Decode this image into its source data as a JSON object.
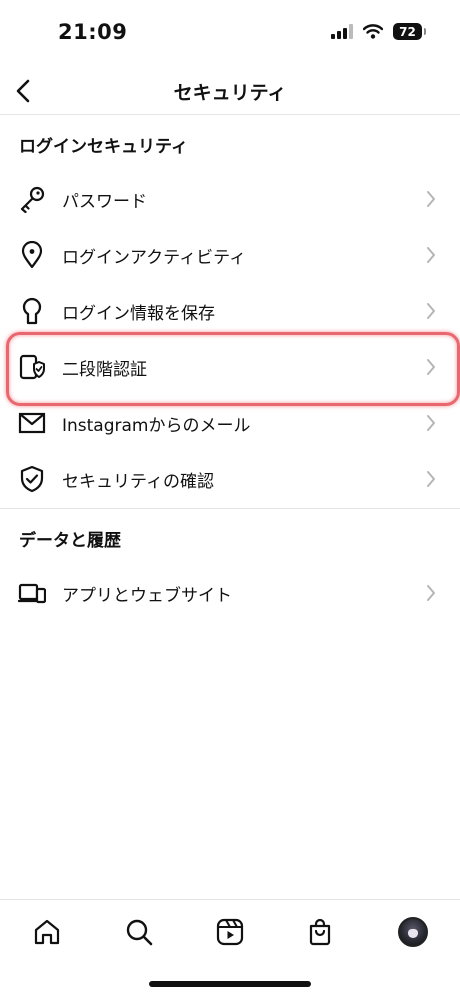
{
  "status_bar": {
    "time": "21:09",
    "battery": "72"
  },
  "header": {
    "title": "セキュリティ"
  },
  "sections": [
    {
      "title": "ログインセキュリティ",
      "items": [
        {
          "label": "パスワード",
          "icon": "key-icon"
        },
        {
          "label": "ログインアクティビティ",
          "icon": "location-pin-icon"
        },
        {
          "label": "ログイン情報を保存",
          "icon": "keyhole-icon"
        },
        {
          "label": "二段階認証",
          "icon": "shield-check-device-icon"
        },
        {
          "label": "Instagramからのメール",
          "icon": "envelope-icon"
        },
        {
          "label": "セキュリティの確認",
          "icon": "shield-check-icon"
        }
      ]
    },
    {
      "title": "データと履歴",
      "items": [
        {
          "label": "アプリとウェブサイト",
          "icon": "devices-icon"
        }
      ]
    }
  ],
  "tab_bar": {
    "tabs": [
      "home-icon",
      "search-icon",
      "reels-icon",
      "shop-icon",
      "profile-avatar"
    ]
  },
  "annotation": {
    "highlighted_item": "二段階認証",
    "color": "#e2353f"
  }
}
